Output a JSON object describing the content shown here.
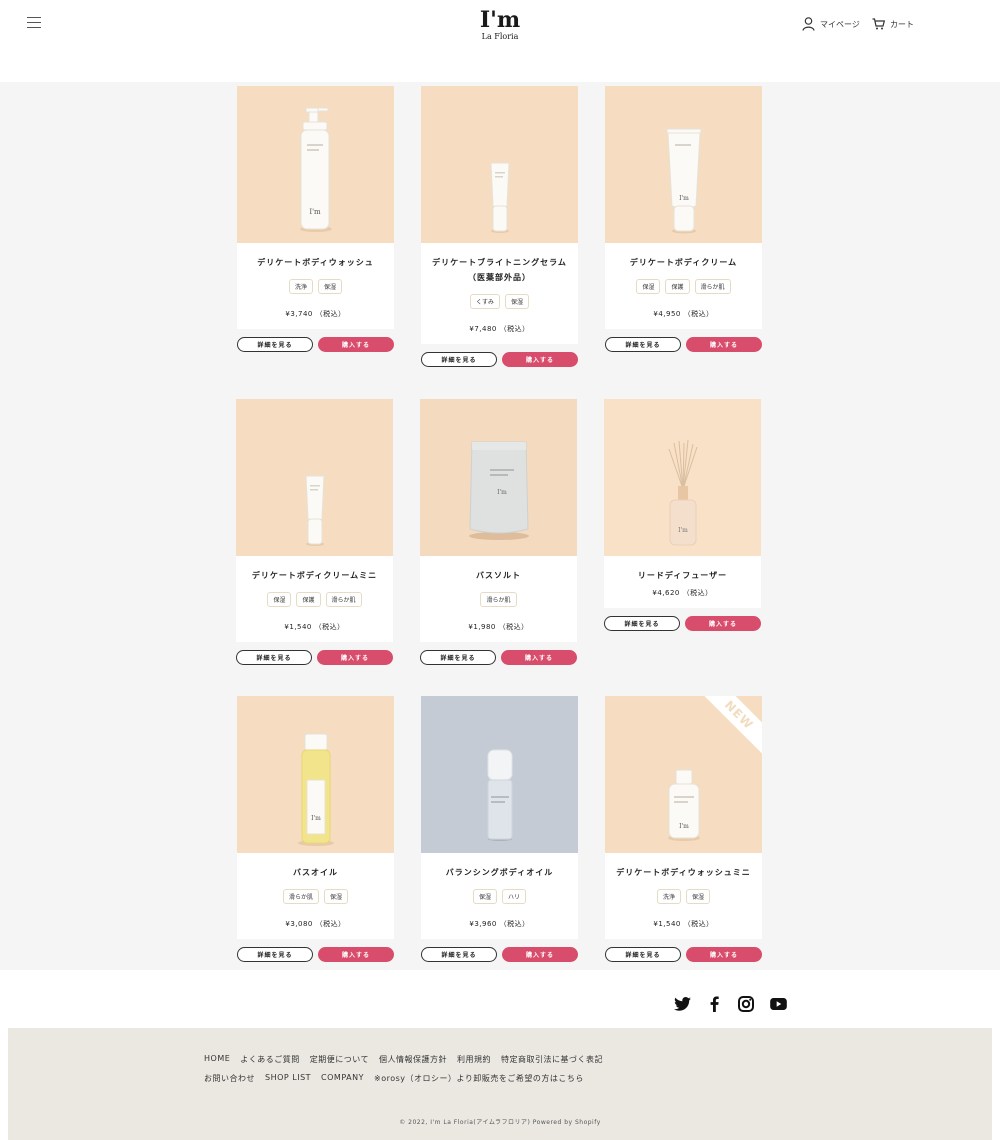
{
  "header": {
    "logo_main": "I'm",
    "logo_sub": "La Floria",
    "mypage_label": "マイページ",
    "cart_label": "カート"
  },
  "buttons": {
    "detail_label": "詳細を見る",
    "buy_label": "購入する"
  },
  "products": [
    {
      "name": "デリケートボディウォッシュ",
      "tags": [
        "洗浄",
        "保湿"
      ],
      "price": "¥3,740 （税込）",
      "image": "pump-bottle",
      "bg": "#f6dcc0"
    },
    {
      "name": "デリケートブライトニングセラム",
      "name2": "（医薬部外品）",
      "tags": [
        "くすみ",
        "保湿"
      ],
      "price": "¥7,480 （税込）",
      "image": "small-tube",
      "bg": "#f6dcc0"
    },
    {
      "name": "デリケートボディクリーム",
      "tags": [
        "保湿",
        "保護",
        "滑らか肌"
      ],
      "price": "¥4,950 （税込）",
      "image": "large-tube",
      "bg": "#f6dcc0"
    },
    {
      "name": "デリケートボディクリームミニ",
      "tags": [
        "保湿",
        "保護",
        "滑らか肌"
      ],
      "price": "¥1,540 （税込）",
      "image": "small-tube",
      "bg": "#f6dcc0"
    },
    {
      "name": "バスソルト",
      "tags": [
        "滑らか肌"
      ],
      "price": "¥1,980 （税込）",
      "image": "pouch",
      "bg": "#f4dabe"
    },
    {
      "name": "リードディフューザー",
      "tags": [],
      "price": "¥4,620 （税込）",
      "image": "diffuser",
      "bg": "#f8e1c7"
    },
    {
      "name": "バスオイル",
      "tags": [
        "滑らか肌",
        "保湿"
      ],
      "price": "¥3,080 （税込）",
      "image": "oil-bottle",
      "bg": "#f6dcc0"
    },
    {
      "name": "バランシングボディオイル",
      "tags": [
        "保湿",
        "ハリ"
      ],
      "price": "¥3,960 （税込）",
      "image": "airless-bottle",
      "bg": "#c4cbd4"
    },
    {
      "name": "デリケートボディウォッシュミニ",
      "tags": [
        "洗浄",
        "保湿"
      ],
      "price": "¥1,540 （税込）",
      "image": "mini-bottle",
      "bg": "#f6dcc0",
      "badge": "NEW"
    }
  ],
  "social": [
    "twitter-icon",
    "facebook-icon",
    "instagram-icon",
    "youtube-icon"
  ],
  "footer": {
    "links_row1": [
      "HOME",
      "よくあるご質問",
      "定期便について",
      "個人情報保護方針",
      "利用規約",
      "特定商取引法に基づく表記"
    ],
    "links_row2": [
      "お問い合わせ",
      "SHOP LIST",
      "COMPANY",
      "※orosy（オロシー）より卸販売をご希望の方はこちら"
    ],
    "copyright": "© 2022, I'm La Floria(アイムラフロリア) Powered by Shopify"
  },
  "colors": {
    "accent": "#d84d6b",
    "page_bg": "#f5f5f5",
    "footer_bg": "#ebe8e2"
  }
}
